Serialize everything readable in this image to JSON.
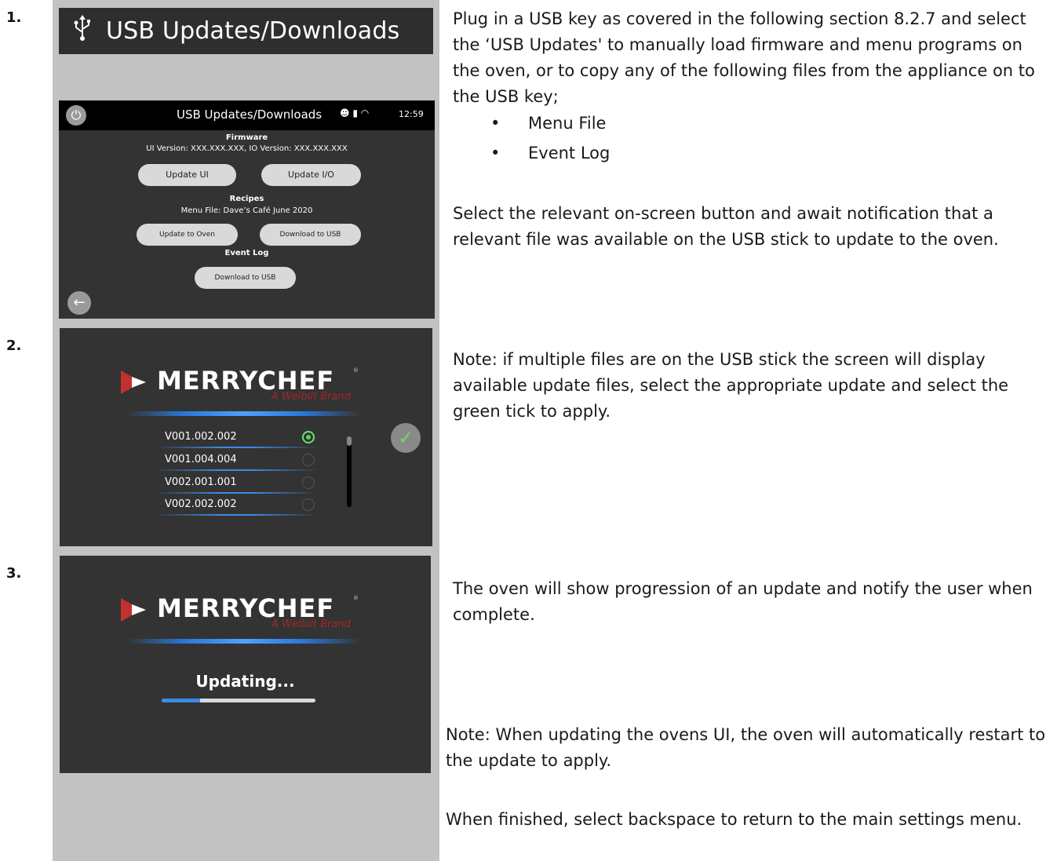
{
  "steps": [
    "1.",
    "2.",
    "3."
  ],
  "banner": {
    "title": "USB Updates/Downloads",
    "icon": "usb-icon"
  },
  "screen1": {
    "bar_title": "USB Updates/Downloads",
    "time": "12:59",
    "firmware_heading": "Firmware",
    "firmware_versions": "UI Version: XXX.XXX.XXX, IO Version: XXX.XXX.XXX",
    "btn_update_ui": "Update UI",
    "btn_update_io": "Update I/O",
    "recipes_heading": "Recipes",
    "menu_file": "Menu File: Dave’s Café June 2020",
    "btn_update_oven": "Update to Oven",
    "btn_download_usb_1": "Download to USB",
    "eventlog_heading": "Event Log",
    "btn_download_usb_2": "Download to USB"
  },
  "screen2": {
    "brand": "MERRYCHEF",
    "brand_sub": "A Welbilt Brand",
    "versions": [
      {
        "label": "V001.002.002",
        "selected": true
      },
      {
        "label": "V001.004.004",
        "selected": false
      },
      {
        "label": "V002.001.001",
        "selected": false
      },
      {
        "label": "V002.002.002",
        "selected": false
      }
    ]
  },
  "screen3": {
    "brand": "MERRYCHEF",
    "brand_sub": "A Welbilt Brand",
    "status": "Updating...",
    "progress": 0.25
  },
  "text": {
    "p1": "Plug in a USB key as covered in the following section 8.2.7 and select the ‘USB Updates' to manually load firmware and menu programs on the oven, or to copy any of the following files from the appliance on to the USB key;",
    "bullet1": "Menu File",
    "bullet2": "Event Log",
    "p2": "Select the relevant on-screen button and await notification that a relevant file was available on the USB stick to update to the oven.",
    "p3": "Note: if multiple files are on the USB stick the screen will display available update files, select the appropriate update and select the green tick to apply.",
    "p4": "The oven will show progression of an update and notify the user when complete.",
    "p5": "Note: When updating the ovens UI, the oven will automatically restart to the update to apply.",
    "p6": "When finished, select backspace to return to the main settings menu."
  },
  "colors": {
    "screen_bg": "#333333",
    "accent_blue": "#3a8ae6",
    "select_green": "#4fdc4f",
    "brand_red": "#a02828"
  }
}
